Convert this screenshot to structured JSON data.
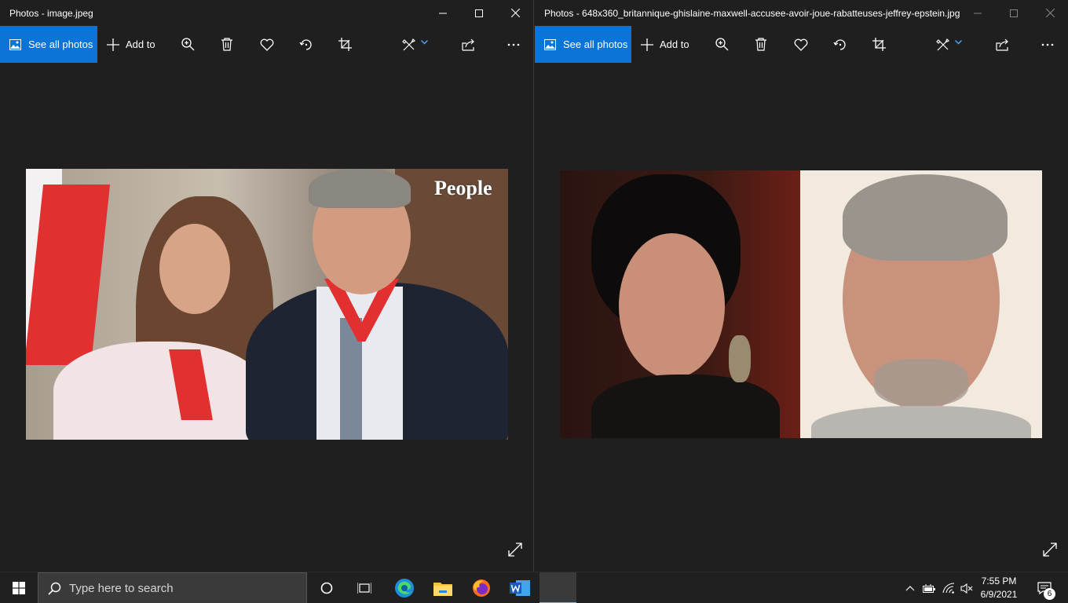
{
  "left_window": {
    "title": "Photos - image.jpeg",
    "toolbar": {
      "see_all": "See all photos",
      "add_to": "Add to"
    },
    "photo": {
      "watermark": "People"
    }
  },
  "right_window": {
    "title": "Photos - 648x360_britannique-ghislaine-maxwell-accusee-avoir-joue-rabatteuses-jeffrey-epstein.jpg",
    "toolbar": {
      "see_all": "See all photos",
      "add_to": "Add to"
    }
  },
  "taskbar": {
    "search_placeholder": "Type here to search",
    "time": "7:55 PM",
    "date": "6/9/2021",
    "notification_count": "6"
  },
  "colors": {
    "accent": "#0a74d9",
    "background": "#1f1f1f",
    "taskbar": "#202020"
  },
  "icons": {
    "toolbar": [
      "image-icon",
      "plus-icon",
      "zoom-in-icon",
      "trash-icon",
      "heart-icon",
      "rotate-icon",
      "crop-icon",
      "edit-icon",
      "chevron-down-icon",
      "share-icon",
      "more-icon"
    ],
    "taskbar": [
      "windows-start-icon",
      "search-icon",
      "cortana-icon",
      "task-view-icon",
      "edge-icon",
      "file-explorer-icon",
      "firefox-icon",
      "word-icon",
      "chevron-up-icon",
      "battery-icon",
      "wifi-icon",
      "volume-muted-icon",
      "action-center-icon"
    ]
  }
}
